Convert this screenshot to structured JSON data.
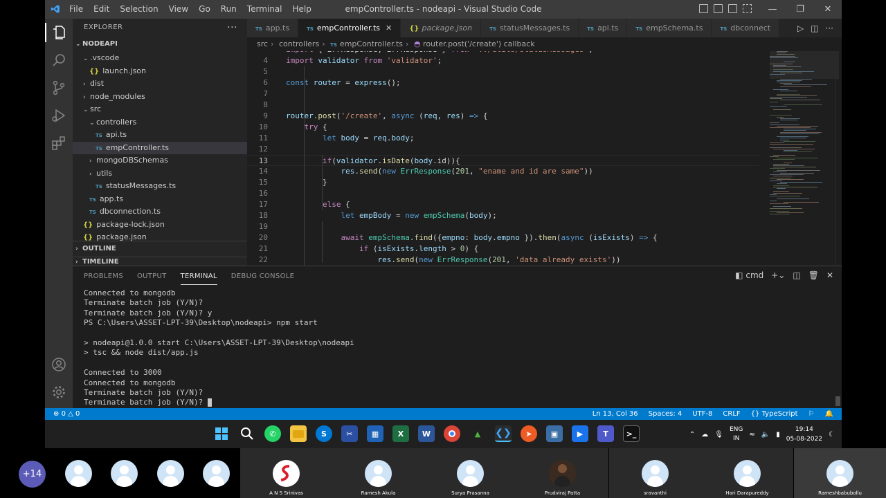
{
  "window": {
    "title": "empController.ts - nodeapi - Visual Studio Code",
    "menu": [
      "File",
      "Edit",
      "Selection",
      "View",
      "Go",
      "Run",
      "Terminal",
      "Help"
    ]
  },
  "sidebar": {
    "header": "EXPLORER",
    "root": "NODEAPI",
    "tree": [
      {
        "label": "vscode",
        "prefix": ".",
        "kind": "folder",
        "open": true,
        "indent": 1
      },
      {
        "label": "launch.json",
        "kind": "json",
        "indent": 2
      },
      {
        "label": "dist",
        "kind": "folder",
        "open": false,
        "indent": 1
      },
      {
        "label": "node_modules",
        "kind": "folder",
        "open": false,
        "indent": 1
      },
      {
        "label": "src",
        "kind": "folder",
        "open": true,
        "indent": 1
      },
      {
        "label": "controllers",
        "kind": "folder",
        "open": true,
        "indent": 2
      },
      {
        "label": "api.ts",
        "kind": "ts",
        "indent": 3
      },
      {
        "label": "empController.ts",
        "kind": "ts",
        "indent": 3,
        "selected": true
      },
      {
        "label": "mongoDBSchemas",
        "kind": "folder",
        "open": false,
        "indent": 2
      },
      {
        "label": "utils",
        "kind": "folder",
        "open": false,
        "indent": 2
      },
      {
        "label": "statusMessages.ts",
        "kind": "ts",
        "indent": 3
      },
      {
        "label": "app.ts",
        "kind": "ts",
        "indent": 2
      },
      {
        "label": "dbconnection.ts",
        "kind": "ts",
        "indent": 2
      },
      {
        "label": "package-lock.json",
        "kind": "json",
        "indent": 1
      },
      {
        "label": "package.json",
        "kind": "json",
        "indent": 1
      }
    ],
    "outline": "OUTLINE",
    "timeline": "TIMELINE"
  },
  "tabs": [
    {
      "label": "app.ts",
      "kind": "ts"
    },
    {
      "label": "empController.ts",
      "kind": "ts",
      "active": true
    },
    {
      "label": "package.json",
      "kind": "json",
      "italic": true
    },
    {
      "label": "statusMessages.ts",
      "kind": "ts"
    },
    {
      "label": "api.ts",
      "kind": "ts"
    },
    {
      "label": "empSchema.ts",
      "kind": "ts"
    },
    {
      "label": "dbconnect",
      "kind": "ts"
    }
  ],
  "breadcrumb": [
    "src",
    "controllers",
    "empController.ts",
    "router.post('/create') callback"
  ],
  "code_lines": [
    {
      "n": "4",
      "text": "import validator from 'validator';"
    },
    {
      "n": "5",
      "text": ""
    },
    {
      "n": "6",
      "text": "const router = express();"
    },
    {
      "n": "7",
      "text": ""
    },
    {
      "n": "8",
      "text": ""
    },
    {
      "n": "9",
      "text": "router.post('/create', async (req, res) => {"
    },
    {
      "n": "10",
      "text": "    try {"
    },
    {
      "n": "11",
      "text": "        let body = req.body;"
    },
    {
      "n": "12",
      "text": ""
    },
    {
      "n": "13",
      "text": "        if(validator.isDate(body.id)){"
    },
    {
      "n": "14",
      "text": "            res.send(new ErrResponse(201, \"ename and id are same\"))"
    },
    {
      "n": "15",
      "text": "        }"
    },
    {
      "n": "16",
      "text": ""
    },
    {
      "n": "17",
      "text": "        else {"
    },
    {
      "n": "18",
      "text": "            let empBody = new empSchema(body);"
    },
    {
      "n": "19",
      "text": ""
    },
    {
      "n": "20",
      "text": "            await empSchema.find({empno: body.empno }).then(async (isExists) => {"
    },
    {
      "n": "21",
      "text": "                if (isExists.length > 0) {"
    },
    {
      "n": "22",
      "text": "                    res.send(new ErrResponse(201, 'data already exists'))"
    }
  ],
  "panel": {
    "tabs": [
      "PROBLEMS",
      "OUTPUT",
      "TERMINAL",
      "DEBUG CONSOLE"
    ],
    "active_tab": "TERMINAL",
    "shell": "cmd",
    "terminal_lines": [
      "Connected to mongodb",
      "Terminate batch job (Y/N)?",
      "Terminate batch job (Y/N)? y",
      "PS C:\\Users\\ASSET-LPT-39\\Desktop\\nodeapi> npm start",
      "",
      "> nodeapi@1.0.0 start C:\\Users\\ASSET-LPT-39\\Desktop\\nodeapi",
      "> tsc && node dist/app.js",
      "",
      "Connected to 3000",
      "Connected to mongodb",
      "Terminate batch job (Y/N)?",
      "Terminate batch job (Y/N)? "
    ]
  },
  "status": {
    "errors": "0",
    "warnings": "0",
    "cursor": "Ln 13, Col 36",
    "spaces": "Spaces: 4",
    "encoding": "UTF-8",
    "eol": "CRLF",
    "language": "TypeScript"
  },
  "taskbar": {
    "lang": "ENG",
    "region": "IN",
    "time": "19:14",
    "date": "05-08-2022"
  },
  "participants": {
    "more": "+14",
    "names": [
      "A N S Srinivas",
      "Ramesh Akula",
      "Surya Prasanna",
      "Prudviraj Patta",
      "sravanthi",
      "Hari Darapureddy",
      "Rameshbabubollu"
    ]
  }
}
